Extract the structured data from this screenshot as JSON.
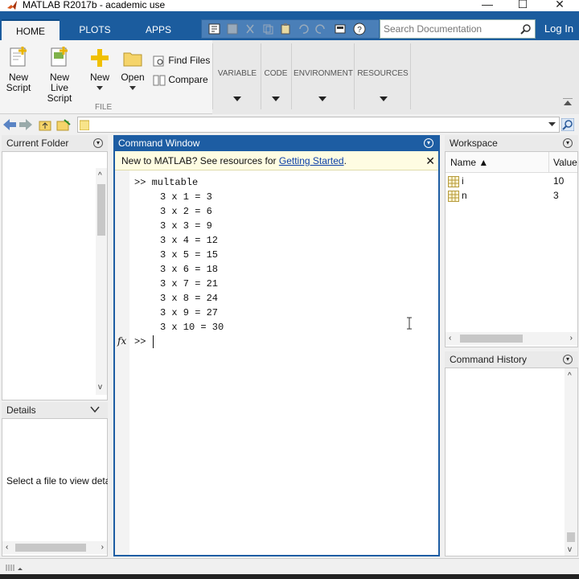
{
  "window": {
    "title": "MATLAB R2017b - academic use",
    "minimize": "—",
    "maximize": "☐",
    "close": "✕"
  },
  "tabs": [
    {
      "label": "HOME"
    },
    {
      "label": "PLOTS"
    },
    {
      "label": "APPS"
    }
  ],
  "search": {
    "placeholder": "Search Documentation"
  },
  "login": "Log In",
  "ribbon": {
    "new_script": {
      "line1": "New",
      "line2": "Script"
    },
    "new_live_script": {
      "line1": "New",
      "line2": "Live Script"
    },
    "new": "New",
    "open": "Open",
    "find_files": "Find Files",
    "compare": "Compare",
    "file_group": "FILE",
    "sections": [
      "VARIABLE",
      "CODE",
      "ENVIRONMENT",
      "RESOURCES"
    ]
  },
  "current_folder": {
    "title": "Current Folder"
  },
  "details": {
    "title": "Details",
    "placeholder": "Select a file to view deta"
  },
  "command_window": {
    "title": "Command Window",
    "banner_text": "New to MATLAB? See resources for ",
    "banner_link": "Getting Started",
    "banner_end": ".",
    "command_line": ">> multable",
    "output": [
      "3 x 1 = 3",
      "3 x 2 = 6",
      "3 x 3 = 9",
      "3 x 4 = 12",
      "3 x 5 = 15",
      "3 x 6 = 18",
      "3 x 7 = 21",
      "3 x 8 = 24",
      "3 x 9 = 27",
      "3 x 10 = 30"
    ],
    "fx": "fx",
    "prompt": ">>"
  },
  "workspace": {
    "title": "Workspace",
    "columns": [
      "Name ▲",
      "Value"
    ],
    "variables": [
      {
        "name": "i",
        "value": "10"
      },
      {
        "name": "n",
        "value": "3"
      }
    ]
  },
  "command_history": {
    "title": "Command History"
  },
  "colors": {
    "accent": "#1b5c9e",
    "banner": "#fefce2",
    "link": "#0b3fa8"
  }
}
